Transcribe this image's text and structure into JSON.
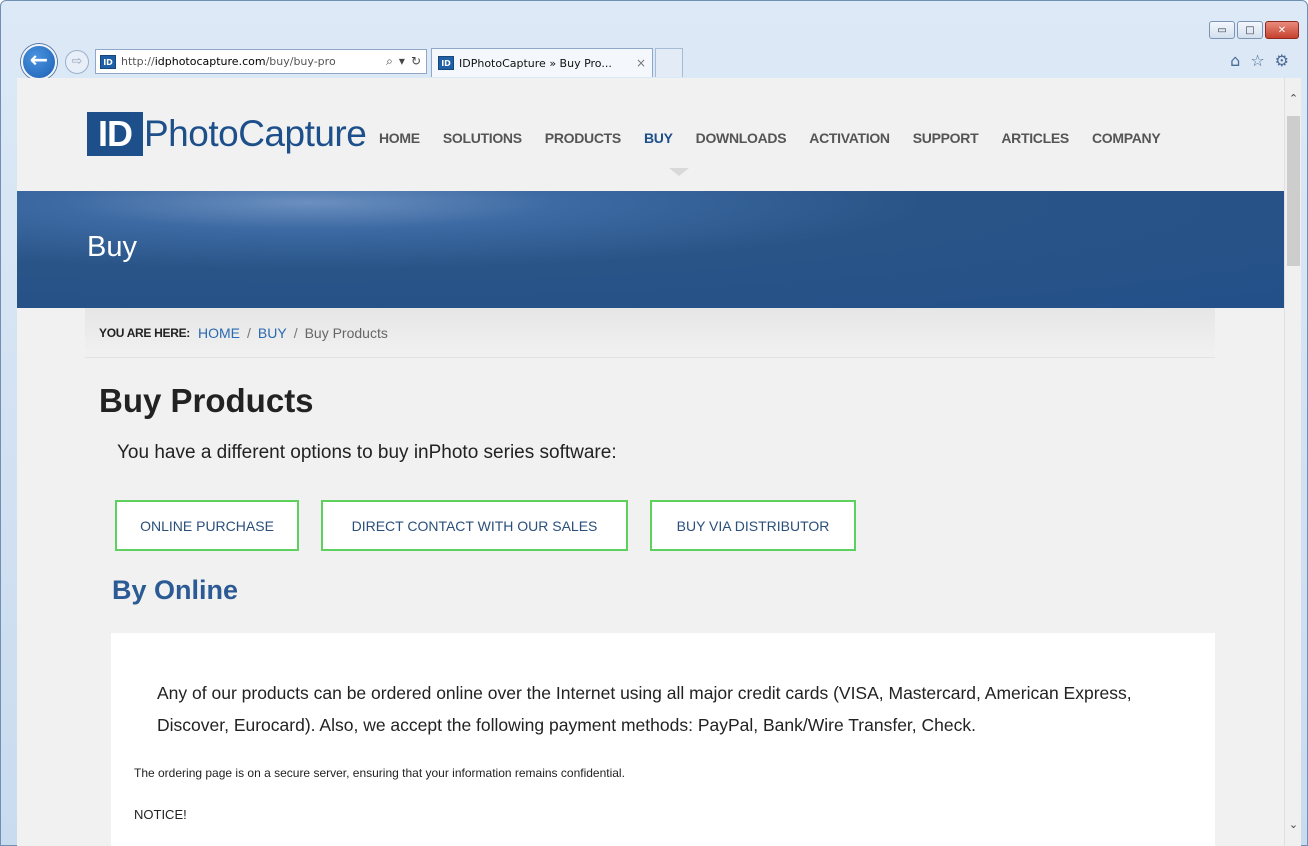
{
  "browser": {
    "address": {
      "prefix": "http://",
      "domain": "idphotocapture.com",
      "path": "/buy/buy-pro",
      "favicon_text": "ID"
    },
    "tab": {
      "title": "IDPhotoCapture » Buy Pro...",
      "close": "×"
    },
    "icons": {
      "back": "←",
      "forward": "⇨",
      "search": "⌕",
      "dropdown": "▾",
      "refresh": "↻",
      "home": "⌂",
      "favorites": "☆",
      "settings": "⚙",
      "minimize": "▭",
      "maximize": "□",
      "close": "✕",
      "scroll_up": "⌃",
      "scroll_down": "⌄"
    }
  },
  "site": {
    "logo": {
      "box_text": "ID",
      "text": "PhotoCapture"
    },
    "nav": [
      "HOME",
      "SOLUTIONS",
      "PRODUCTS",
      "BUY",
      "DOWNLOADS",
      "ACTIVATION",
      "SUPPORT",
      "ARTICLES",
      "COMPANY"
    ],
    "active_nav": "BUY",
    "banner_title": "Buy",
    "breadcrumb": {
      "label": "YOU ARE HERE:",
      "home": "HOME",
      "buy": "BUY",
      "separator": "/",
      "current": "Buy Products"
    },
    "page_title": "Buy Products",
    "intro": "You have a different options to buy inPhoto series software:",
    "options": [
      "ONLINE PURCHASE",
      "DIRECT CONTACT WITH OUR SALES",
      "BUY VIA DISTRIBUTOR"
    ],
    "section_heading": "By Online",
    "content": {
      "para1": "Any of our products can be ordered online over the Internet using all major credit cards (VISA, Mastercard, American Express, Discover, Eurocard). Also, we accept the following payment methods: PayPal, Bank/Wire Transfer, Check.",
      "para2": "The ordering page is on a secure server, ensuring that your information remains confidential.",
      "para3": "NOTICE!"
    }
  },
  "colors": {
    "brand": "#1d4f8a",
    "banner": "#285487",
    "link": "#2a6ab0",
    "button_border": "#5ed05e",
    "heading": "#2b5a94"
  }
}
